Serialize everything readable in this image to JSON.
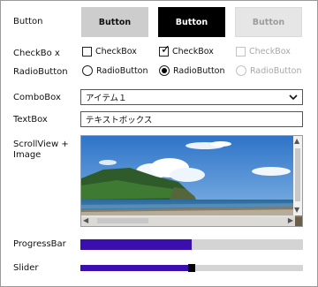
{
  "labels": {
    "button": "Button",
    "checkbox": "CheckBo x",
    "radiobutton": "RadioButton",
    "combobox": "ComboBox",
    "textbox": "TextBox",
    "scrollview": "ScrollView + Image",
    "progressbar": "ProgressBar",
    "slider": "Slider"
  },
  "buttons": [
    {
      "label": "Button",
      "state": "normal"
    },
    {
      "label": "Button",
      "state": "pressed"
    },
    {
      "label": "Button",
      "state": "disabled"
    }
  ],
  "checkboxes": [
    {
      "label": "CheckBox",
      "checked": false,
      "enabled": true
    },
    {
      "label": "CheckBox",
      "checked": true,
      "enabled": true
    },
    {
      "label": "CheckBox",
      "checked": false,
      "enabled": false
    }
  ],
  "radiobuttons": [
    {
      "label": "RadioButton",
      "selected": false,
      "enabled": true
    },
    {
      "label": "RadioButton",
      "selected": true,
      "enabled": true
    },
    {
      "label": "RadioButton",
      "selected": false,
      "enabled": false
    }
  ],
  "combobox": {
    "value": "アイテム１"
  },
  "textbox": {
    "value": "テキストボックス"
  },
  "progress": {
    "fraction": 0.5
  },
  "slider": {
    "fraction": 0.5
  },
  "colors": {
    "accent": "#3a0fae",
    "track": "#d4d4d4"
  }
}
